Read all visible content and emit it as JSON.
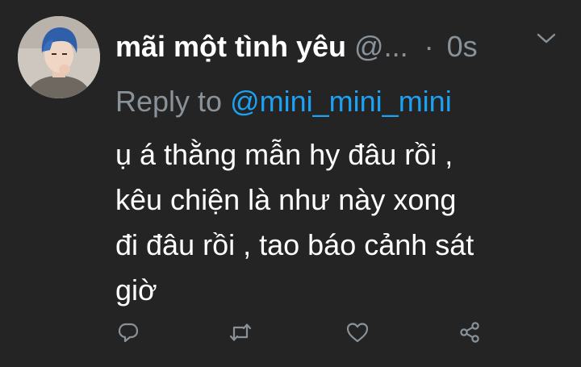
{
  "tweet": {
    "display_name": "mãi một tình yêu",
    "handle": "@...",
    "separator": "·",
    "time": "0s",
    "reply_label": "Reply to",
    "reply_handle": "@mini_mini_mini",
    "text_lines": [
      "ụ á thằng mẫn hy đâu rồi ,",
      "kêu chiện là như này xong",
      "đi đâu rồi , tao báo cảnh sát",
      "giờ"
    ]
  },
  "icons": {
    "avatar": "avatar-photo",
    "menu": "chevron-down-icon",
    "reply": "reply-icon",
    "retweet": "retweet-icon",
    "like": "heart-icon",
    "share": "share-icon"
  },
  "colors": {
    "background": "#242424",
    "text": "#ffffff",
    "secondary": "#8a9299",
    "link": "#1da1f2"
  }
}
